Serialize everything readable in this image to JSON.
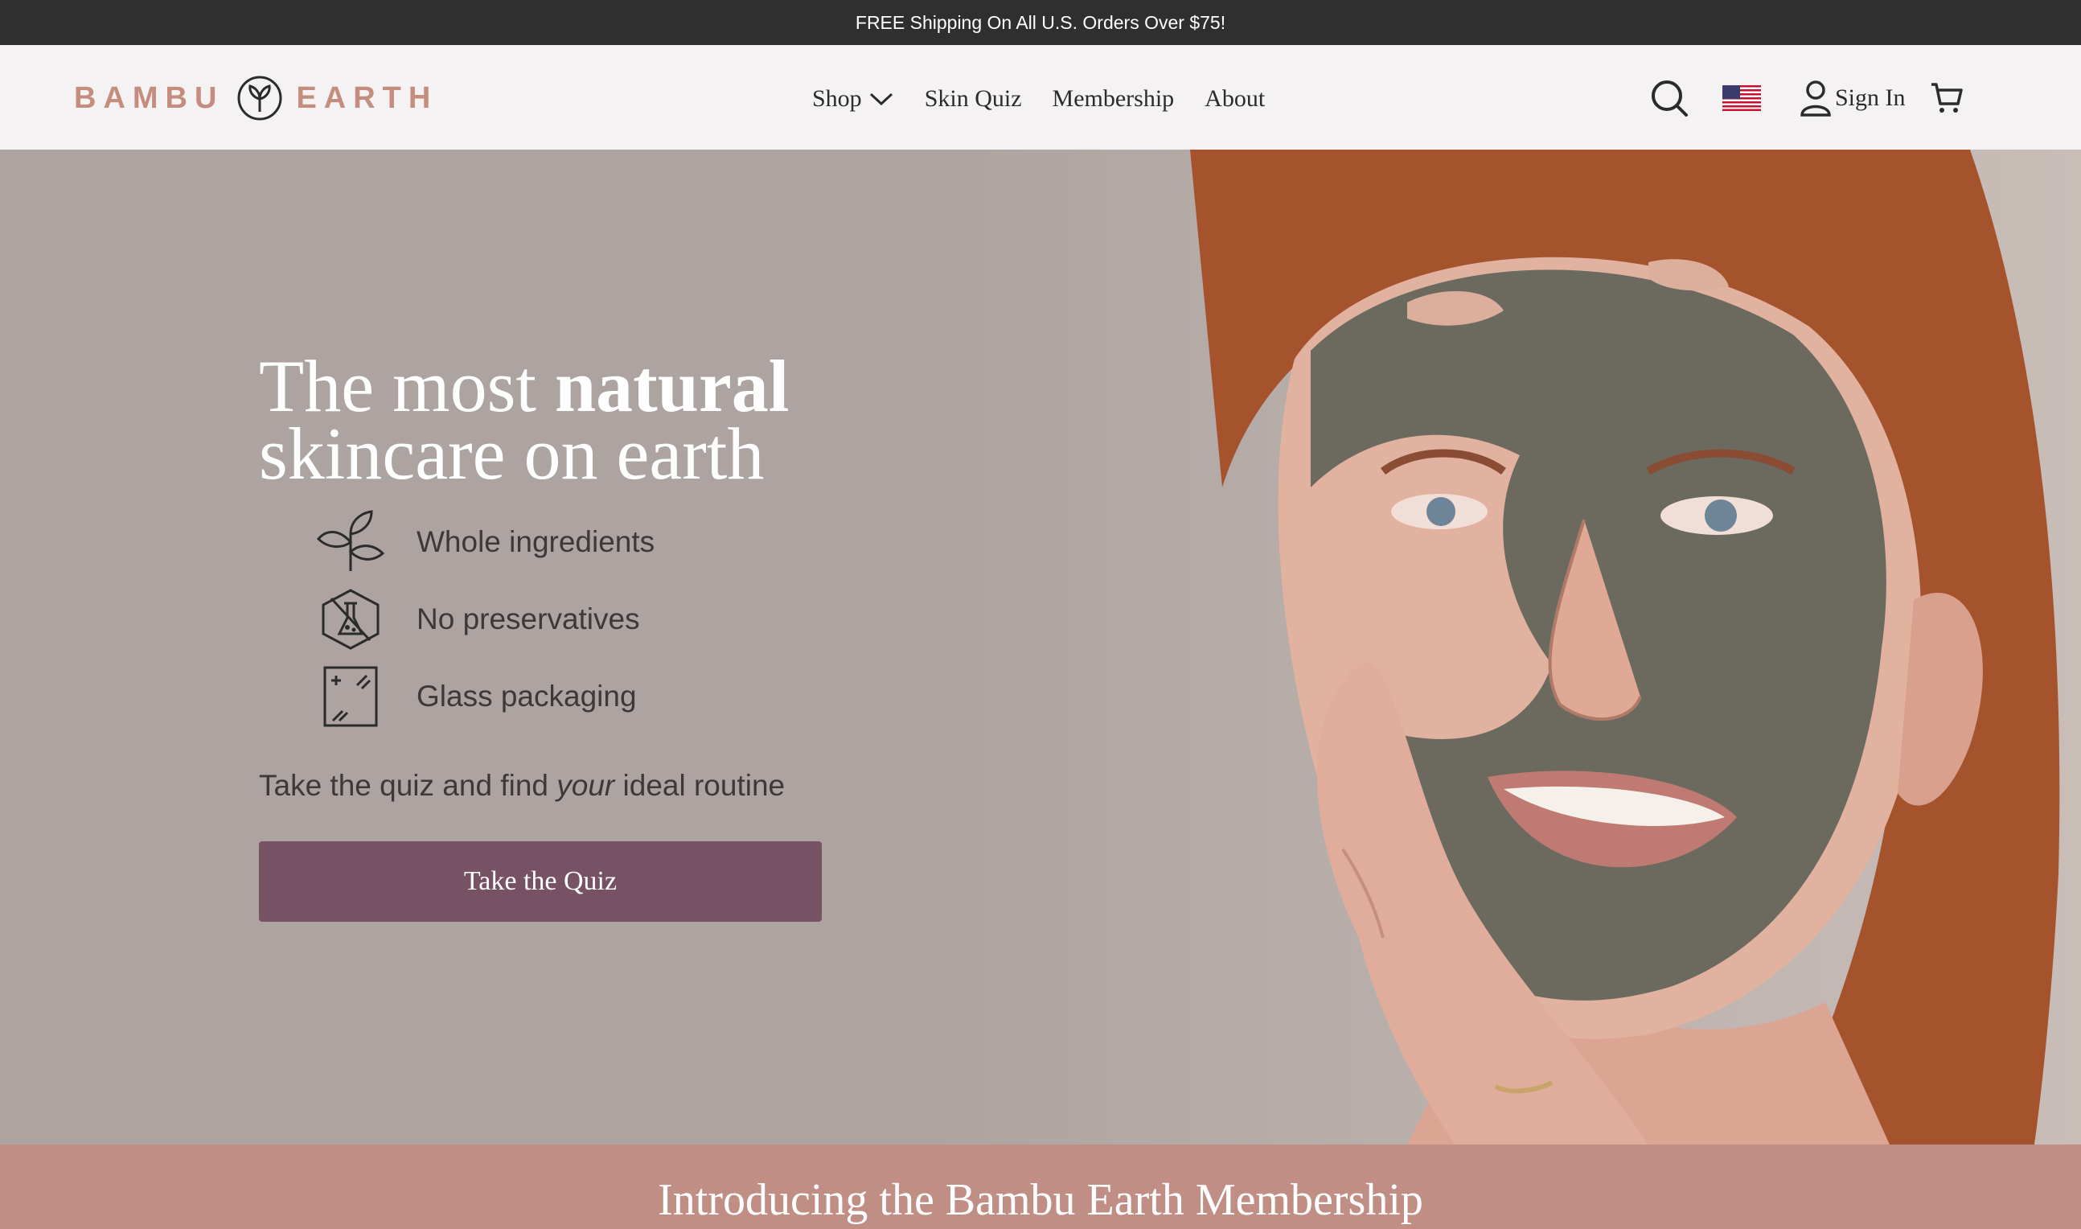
{
  "announcement": {
    "text": "FREE Shipping On All U.S. Orders Over $75!"
  },
  "logo": {
    "left": "BAMBU",
    "right": "EARTH"
  },
  "nav": [
    {
      "label": "Shop",
      "has_dropdown": true
    },
    {
      "label": "Skin Quiz"
    },
    {
      "label": "Membership"
    },
    {
      "label": "About"
    }
  ],
  "header_utils": {
    "search_icon": "search-icon",
    "flag_icon": "us-flag-icon",
    "signin_label": "Sign In",
    "cart_icon": "cart-icon"
  },
  "hero": {
    "headline_part1": "The most ",
    "headline_bold": "natural",
    "headline_part2": "skincare on earth",
    "features": [
      {
        "icon": "sprout-icon",
        "label": "Whole ingredients"
      },
      {
        "icon": "no-preservatives-icon",
        "label": "No preservatives"
      },
      {
        "icon": "glass-icon",
        "label": "Glass packaging"
      }
    ],
    "quiz_line_before": "Take the quiz and find ",
    "quiz_line_em": "your",
    "quiz_line_after": " ideal routine",
    "cta_label": "Take the Quiz"
  },
  "membership": {
    "title": "Introducing the Bambu Earth Membership"
  },
  "colors": {
    "announcement_bg": "#2f2f2f",
    "header_bg": "#f4f2f2",
    "logo": "#c58d7d",
    "hero_bg": "#ada4a1",
    "cta_bg": "#775264",
    "membership_bg": "#c08e84"
  }
}
